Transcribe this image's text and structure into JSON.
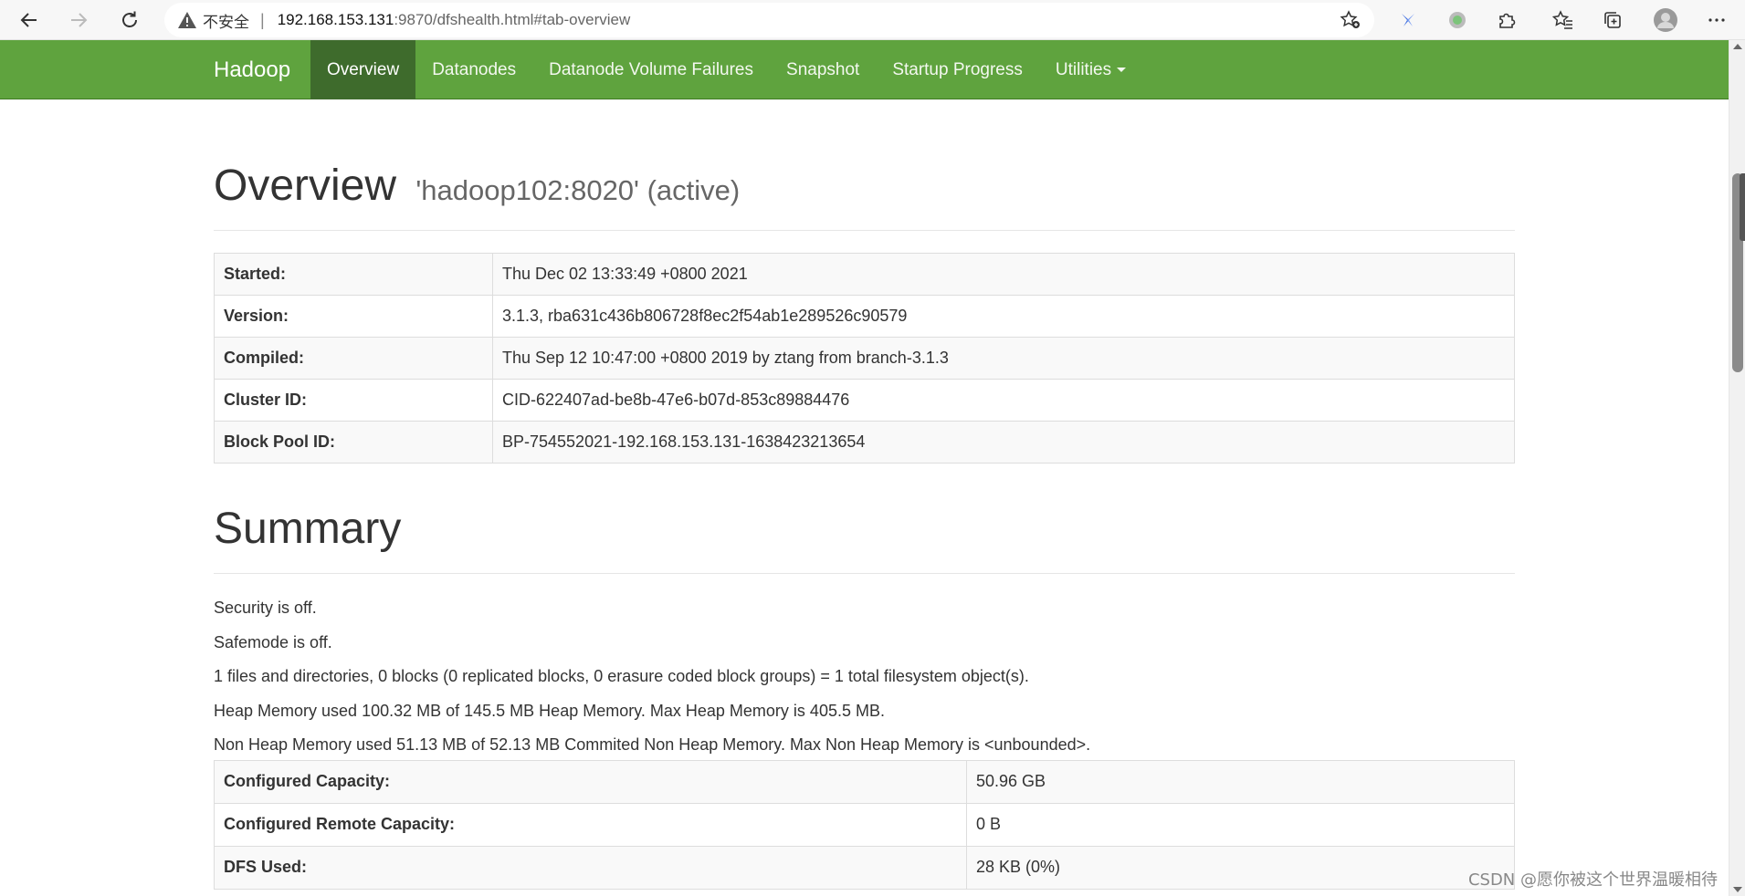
{
  "browser": {
    "insecure_label": "不安全",
    "url_host": "192.168.153.131",
    "url_rest": ":9870/dfshealth.html#tab-overview"
  },
  "navbar": {
    "brand": "Hadoop",
    "items": [
      {
        "label": "Overview",
        "active": true
      },
      {
        "label": "Datanodes"
      },
      {
        "label": "Datanode Volume Failures"
      },
      {
        "label": "Snapshot"
      },
      {
        "label": "Startup Progress"
      },
      {
        "label": "Utilities"
      }
    ]
  },
  "overview": {
    "title": "Overview",
    "subtitle": "'hadoop102:8020' (active)",
    "rows": [
      {
        "key": "Started:",
        "value": "Thu Dec 02 13:33:49 +0800 2021"
      },
      {
        "key": "Version:",
        "value": "3.1.3, rba631c436b806728f8ec2f54ab1e289526c90579"
      },
      {
        "key": "Compiled:",
        "value": "Thu Sep 12 10:47:00 +0800 2019 by ztang from branch-3.1.3"
      },
      {
        "key": "Cluster ID:",
        "value": "CID-622407ad-be8b-47e6-b07d-853c89884476"
      },
      {
        "key": "Block Pool ID:",
        "value": "BP-754552021-192.168.153.131-1638423213654"
      }
    ]
  },
  "summary": {
    "title": "Summary",
    "lines": [
      "Security is off.",
      "Safemode is off.",
      "1 files and directories, 0 blocks (0 replicated blocks, 0 erasure coded block groups) = 1 total filesystem object(s).",
      "Heap Memory used 100.32 MB of 145.5 MB Heap Memory. Max Heap Memory is 405.5 MB.",
      "Non Heap Memory used 51.13 MB of 52.13 MB Commited Non Heap Memory. Max Non Heap Memory is <unbounded>."
    ],
    "rows": [
      {
        "key": "Configured Capacity:",
        "value": "50.96 GB"
      },
      {
        "key": "Configured Remote Capacity:",
        "value": "0 B"
      },
      {
        "key": "DFS Used:",
        "value": "28 KB (0%)"
      }
    ]
  },
  "watermark": "CSDN @愿你被这个世界温暖相待"
}
